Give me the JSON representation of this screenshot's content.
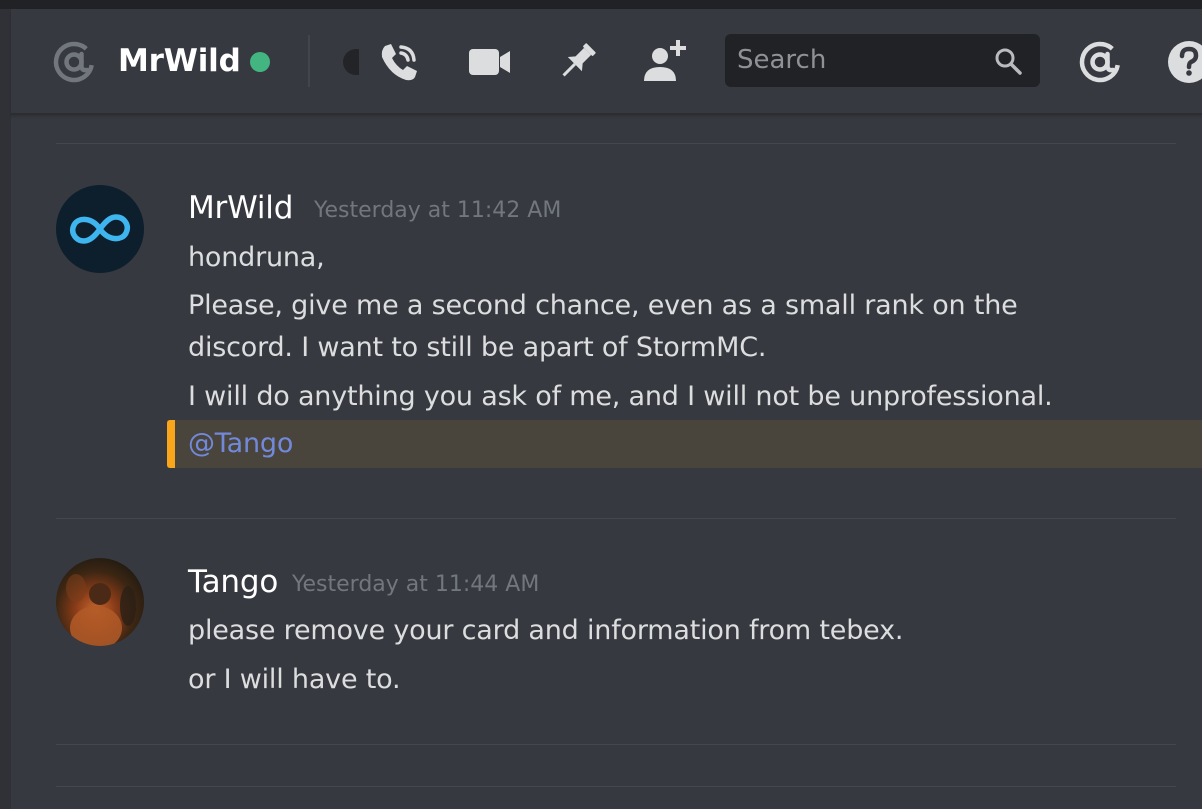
{
  "header": {
    "channel_name": "MrWild",
    "status": "online",
    "status_color": "#43b581",
    "icons": [
      "at-icon",
      "call-icon",
      "video-icon",
      "pin-icon",
      "add-member-icon",
      "mentions-icon",
      "help-icon"
    ],
    "search_placeholder": "Search"
  },
  "messages": [
    {
      "author": "MrWild",
      "timestamp": "Yesterday at 11:42 AM",
      "lines": [
        "hondruna,",
        "Please, give me a second chance, even as a small rank on the",
        "discord. I want to still be apart of StormMC.",
        "I will do anything you ask of me, and I will not be unprofessional."
      ],
      "mention": "@Tango",
      "mention_highlight_color": "#faa61a"
    },
    {
      "author": "Tango",
      "timestamp": "Yesterday at 11:44 AM",
      "lines": [
        "please remove your card and information from tebex.",
        "or I will have to."
      ]
    }
  ]
}
